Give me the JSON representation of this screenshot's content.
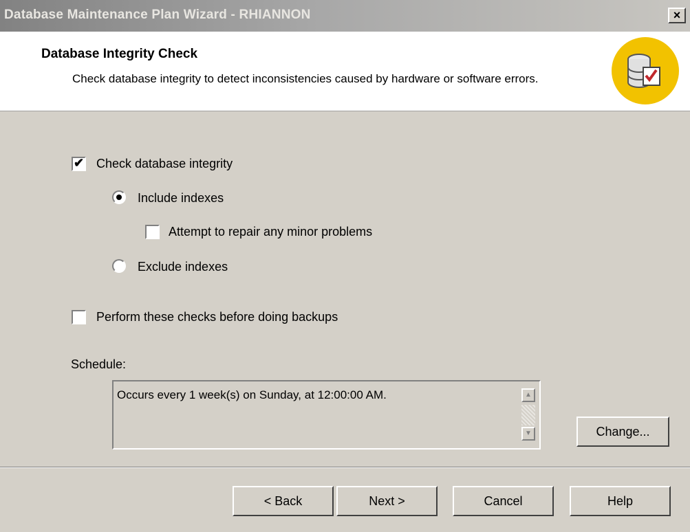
{
  "window": {
    "title": "Database Maintenance Plan Wizard - RHIANNON",
    "close_label": "×"
  },
  "header": {
    "title": "Database Integrity Check",
    "description": "Check database integrity to detect inconsistencies caused by hardware or software errors.",
    "icon": "database-check-icon"
  },
  "options": {
    "check_integrity": {
      "label": "Check database integrity",
      "checked": true
    },
    "include_indexes": {
      "label": "Include indexes",
      "selected": true
    },
    "attempt_repair": {
      "label": "Attempt to repair any minor problems",
      "checked": false
    },
    "exclude_indexes": {
      "label": "Exclude indexes",
      "selected": false
    },
    "checks_before_backup": {
      "label": "Perform these checks before doing backups",
      "checked": false
    }
  },
  "schedule": {
    "label": "Schedule:",
    "text": "Occurs every 1 week(s) on Sunday, at 12:00:00 AM.",
    "change_label": "Change..."
  },
  "buttons": {
    "back": "< Back",
    "next": "Next >",
    "cancel": "Cancel",
    "help": "Help"
  },
  "colors": {
    "face": "#d4d0c8",
    "header_bg": "#ffffff",
    "icon_bg": "#f2c200"
  }
}
